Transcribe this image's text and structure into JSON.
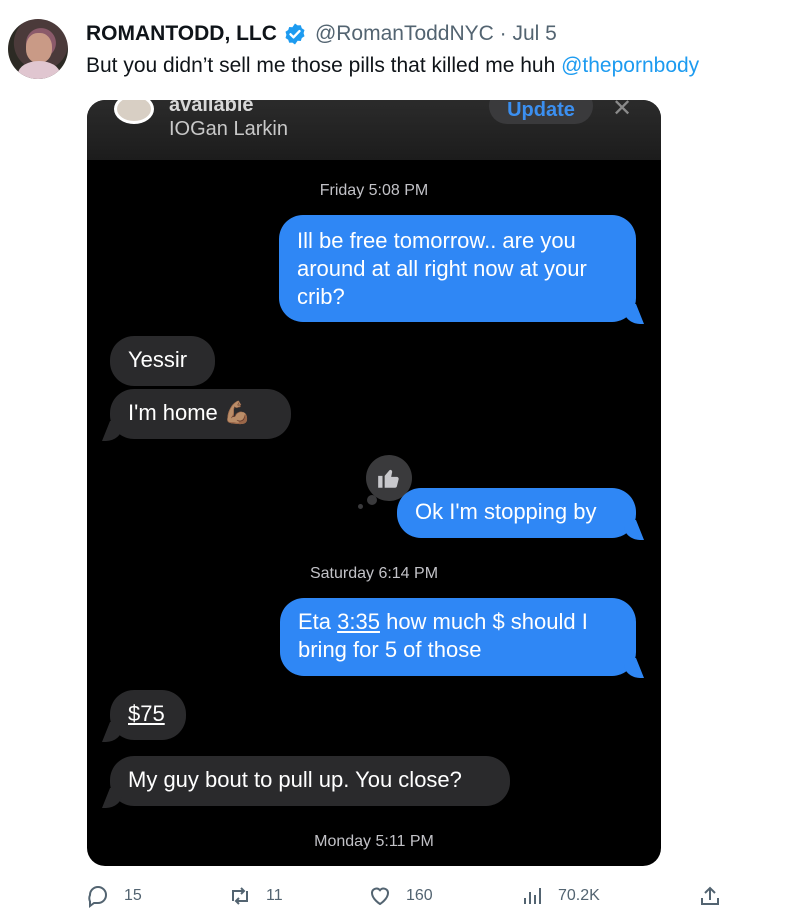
{
  "tweet": {
    "author_name": "ROMANTODD, LLC",
    "handle_date": "@RomanToddNYC · Jul 5",
    "text": "But you didn’t sell me those pills that killed me huh ",
    "mention": "@thepornbody"
  },
  "screenshot": {
    "contact_status": "available",
    "contact_name": "IOGan Larkin",
    "update_label": "Update",
    "close_glyph": "✕",
    "messages": [
      {
        "type": "timestamp",
        "text": "Friday 5:08 PM"
      },
      {
        "type": "out",
        "text": "Ill be free tomorrow.. are you around at all right now at your crib?"
      },
      {
        "type": "in",
        "text": "Yessir"
      },
      {
        "type": "in",
        "text": "I'm home 💪🏽"
      },
      {
        "type": "reaction",
        "icon": "thumbs-up-icon"
      },
      {
        "type": "out",
        "text": "Ok I'm stopping by"
      },
      {
        "type": "timestamp",
        "text": "Saturday 6:14 PM"
      },
      {
        "type": "out",
        "text": "Eta 3:35 how much $ should I bring for 5 of those"
      },
      {
        "type": "in",
        "text": "$75"
      },
      {
        "type": "in",
        "text": "My guy bout to pull up. You close?"
      },
      {
        "type": "timestamp",
        "text": "Monday 5:11 PM"
      }
    ],
    "out_bubble_line1": "Ill be free tomorrow.. are you",
    "out_bubble_line2": "around at all right now at your",
    "out_bubble_line3": "crib?",
    "eta_line1_time": "3:35",
    "eta_line1_rest": " how much $ should I",
    "eta_line1_prefix": "Eta ",
    "eta_line2": "bring for 5 of those",
    "home_text": "I'm home ",
    "home_emoji": "💪🏽"
  },
  "actions": {
    "replies": "15",
    "reposts": "11",
    "likes": "160",
    "views": "70.2K"
  },
  "colors": {
    "accent": "#1d9bf0",
    "imessage_blue": "#2f87f5",
    "incoming_gray": "#2a2a2c"
  }
}
